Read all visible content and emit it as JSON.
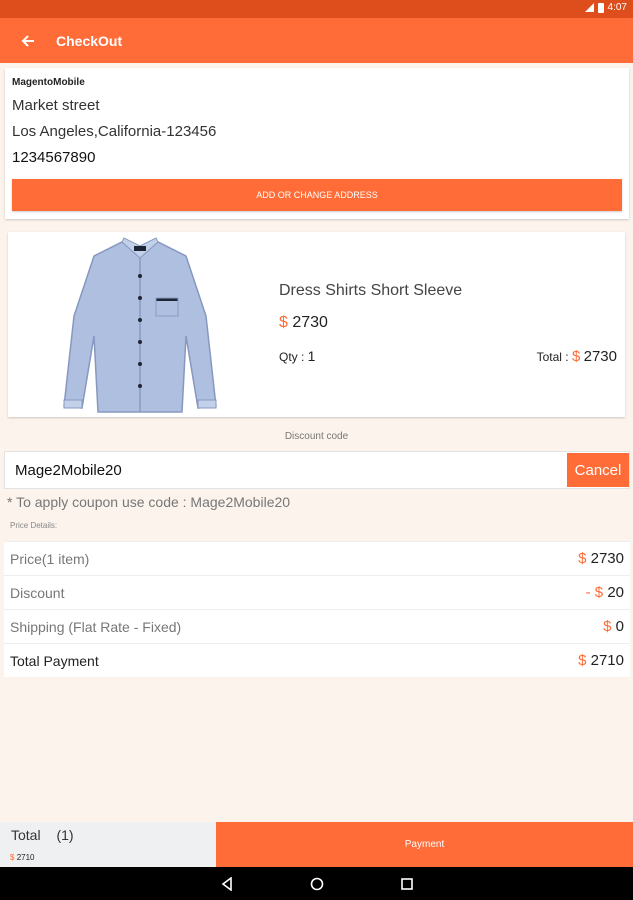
{
  "status_bar": {
    "time": "4:07"
  },
  "header": {
    "title": "CheckOut",
    "back_icon": "arrow-left-icon"
  },
  "address": {
    "name": "MagentoMobile",
    "street": "Market street",
    "city": "Los Angeles,California-123456",
    "phone": "1234567890",
    "button_label": "ADD OR CHANGE ADDRESS"
  },
  "product": {
    "name": "Dress Shirts Short Sleeve",
    "currency": "$",
    "price": "2730",
    "qty_label": "Qty : ",
    "qty": "1",
    "total_label": "Total : ",
    "total": "2730"
  },
  "discount": {
    "label": "Discount code",
    "code": "Mage2Mobile20",
    "cancel_label": "Cancel",
    "hint": "* To apply coupon use code : Mage2Mobile20"
  },
  "price_details": {
    "label": "Price Details:",
    "rows": [
      {
        "label": "Price(1 item)",
        "prefix": "",
        "currency": "$",
        "value": "2730"
      },
      {
        "label": "Discount",
        "prefix": "- ",
        "currency": "$",
        "value": "20"
      },
      {
        "label": "Shipping (Flat Rate - Fixed)",
        "prefix": "",
        "currency": "$",
        "value": "0"
      },
      {
        "label": "Total Payment",
        "prefix": "",
        "currency": "$",
        "value": "2710"
      }
    ]
  },
  "footer": {
    "total_label": "Total",
    "count": "(1)",
    "currency": "$",
    "amount": "2710",
    "payment_label": "Payment"
  },
  "colors": {
    "accent": "#ff6c37",
    "status_bar": "#de4d1c",
    "background": "#fbf3ec"
  }
}
